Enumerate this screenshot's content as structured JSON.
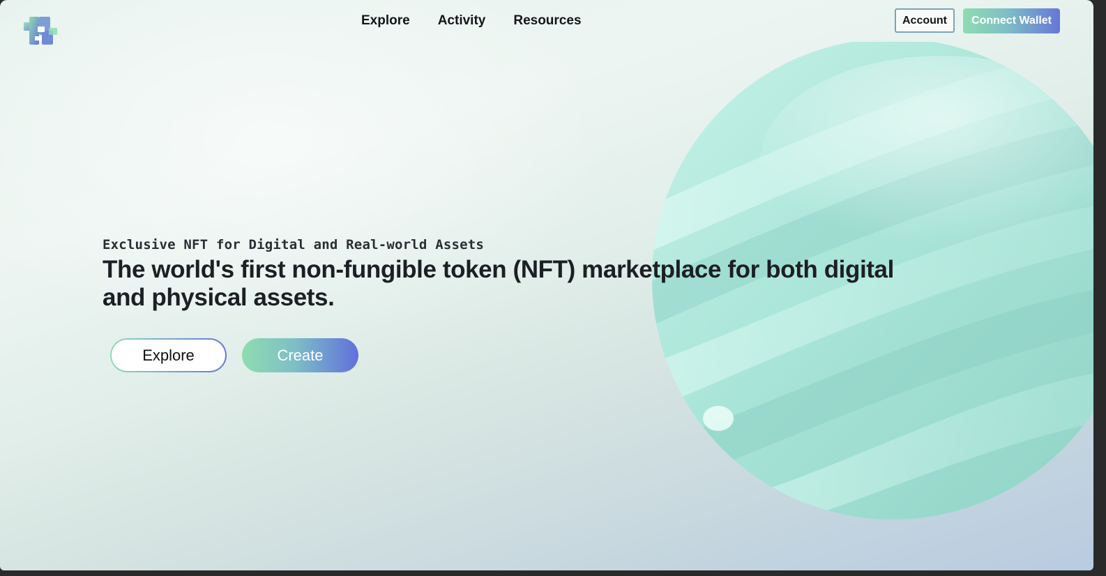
{
  "logo": {
    "icon": "brand-logo-icon"
  },
  "nav": {
    "items": [
      {
        "label": "Explore"
      },
      {
        "label": "Activity"
      },
      {
        "label": "Resources"
      }
    ]
  },
  "header": {
    "account_label": "Account",
    "connect_wallet_label": "Connect Wallet"
  },
  "hero": {
    "eyebrow": "Exclusive NFT for Digital and Real-world Assets",
    "headline": "The world's first non-fungible token (NFT) marketplace for both digital and physical assets.",
    "explore_label": "Explore",
    "create_label": "Create",
    "art": "abstract-mint-sphere"
  },
  "colors": {
    "accent_green": "#8fdcb1",
    "accent_blue": "#6676d8",
    "text_dark": "#1c1f24",
    "sphere_mint": "#a6e3d6"
  }
}
